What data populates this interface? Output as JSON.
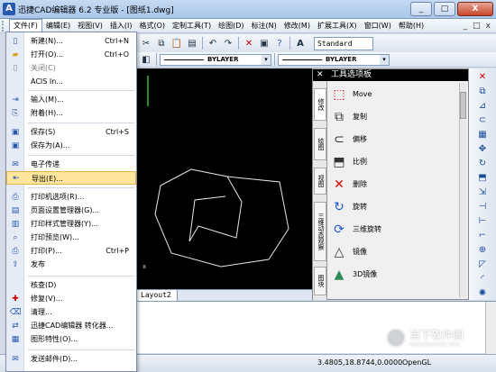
{
  "app": {
    "title": "迅捷CAD编辑器 6.2 专业版 - [图纸1.dwg]",
    "icon_letter": "A"
  },
  "window_buttons": {
    "minimize": "_",
    "maximize": "□",
    "close": "X"
  },
  "menubar": {
    "items": [
      "文件(F)",
      "编辑(E)",
      "视图(V)",
      "插入(I)",
      "格式(O)",
      "定制工具(T)",
      "绘图(D)",
      "标注(N)",
      "修改(M)",
      "扩展工具(X)",
      "窗口(W)",
      "帮助(H)"
    ],
    "right_controls": [
      "_",
      "□",
      "x"
    ]
  },
  "toolbar": {
    "text_style": "Standard",
    "layer_line_1": "BYLAYER",
    "layer_line_2": "BYLAYER"
  },
  "file_menu": {
    "items": [
      {
        "label": "新建(N)...",
        "shortcut": "Ctrl+N",
        "icon": "new-file-icon"
      },
      {
        "label": "打开(O)...",
        "shortcut": "Ctrl+O",
        "icon": "open-folder-icon"
      },
      {
        "label": "关闭(C)",
        "shortcut": "",
        "icon": "close-doc-icon"
      },
      {
        "label": "ACIS In...",
        "shortcut": "",
        "icon": ""
      },
      {
        "label": "输入(M)...",
        "shortcut": "",
        "icon": "import-icon"
      },
      {
        "label": "附着(H)...",
        "shortcut": "",
        "icon": "attach-icon"
      },
      {
        "label": "保存(S)",
        "shortcut": "Ctrl+S",
        "icon": "save-icon"
      },
      {
        "label": "保存为(A)...",
        "shortcut": "",
        "icon": "save-as-icon"
      },
      {
        "label": "电子传递",
        "shortcut": "",
        "icon": "etransmit-icon"
      },
      {
        "label": "导出(E)...",
        "shortcut": "",
        "icon": "export-icon"
      },
      {
        "label": "打印机选项(R)...",
        "shortcut": "",
        "icon": "printer-options-icon"
      },
      {
        "label": "页面设置管理器(G)...",
        "shortcut": "",
        "icon": "page-setup-icon"
      },
      {
        "label": "打印样式管理器(Y)...",
        "shortcut": "",
        "icon": "plot-style-icon"
      },
      {
        "label": "打印预览(W)...",
        "shortcut": "",
        "icon": "print-preview-icon"
      },
      {
        "label": "打印(P)...",
        "shortcut": "Ctrl+P",
        "icon": "print-icon"
      },
      {
        "label": "发布",
        "shortcut": "",
        "icon": "publish-icon"
      },
      {
        "label": "核查(D)",
        "shortcut": "",
        "icon": "audit-icon"
      },
      {
        "label": "修复(V)...",
        "shortcut": "",
        "icon": "repair-icon"
      },
      {
        "label": "清理...",
        "shortcut": "",
        "icon": "purge-icon"
      },
      {
        "label": "迅捷CAD编辑器 转化器...",
        "shortcut": "",
        "icon": "converter-icon"
      },
      {
        "label": "图形特性(O)...",
        "shortcut": "",
        "icon": "drawing-props-icon"
      },
      {
        "label": "发送邮件(D)...",
        "shortcut": "",
        "icon": "send-mail-icon"
      }
    ]
  },
  "palette": {
    "title": "工具选项板",
    "tabs": [
      "修改",
      "绘图",
      "视图",
      "三维动态观察",
      "图块"
    ],
    "items": [
      {
        "label": "Move",
        "icon": "move-icon"
      },
      {
        "label": "复制",
        "icon": "copy-icon"
      },
      {
        "label": "偏移",
        "icon": "offset-icon"
      },
      {
        "label": "比例",
        "icon": "scale-icon"
      },
      {
        "label": "删除",
        "icon": "erase-icon"
      },
      {
        "label": "旋转",
        "icon": "rotate-icon"
      },
      {
        "label": "三维旋转",
        "icon": "rotate-3d-icon"
      },
      {
        "label": "镜像",
        "icon": "mirror-icon"
      },
      {
        "label": "3D镜像",
        "icon": "mirror-3d-icon"
      }
    ]
  },
  "canvas": {
    "layout_tab": "Layout2"
  },
  "status": {
    "coords": "3.4805,18.8744,0.0000",
    "opengl": "OpenGL"
  },
  "watermark": {
    "text": "当下软件园",
    "sub": "www.downxia.com"
  }
}
